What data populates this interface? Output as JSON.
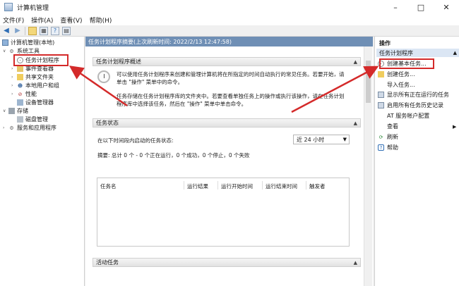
{
  "window": {
    "title": "计算机管理",
    "minimize": "–",
    "maximize": "□",
    "close": "✕"
  },
  "menu": [
    "文件(F)",
    "操作(A)",
    "查看(V)",
    "帮助(H)"
  ],
  "tree": {
    "root": "计算机管理(本地)",
    "system_tools": "系统工具",
    "task_scheduler": "任务计划程序",
    "event_viewer": "事件查看器",
    "shared_folders": "共享文件夹",
    "local_users": "本地用户和组",
    "performance": "性能",
    "device_manager": "设备管理器",
    "storage": "存储",
    "disk_management": "磁盘管理",
    "services_apps": "服务和应用程序"
  },
  "center": {
    "header": "任务计划程序摘要(上次刷新时间: 2022/2/13 12:47:58)",
    "overview_title": "任务计划程序概述",
    "overview_p1_l1": "可以使用任务计划程序来创建和管理计算机将在所指定的时间自动执行的常见任务。若要开始，请",
    "overview_p1_l2": "单击 \"操作\" 菜单中的命令。",
    "overview_p2_l1": "任务存储在任务计划程序库的文件夹中。若要查看单独任务上的操作或执行该操作，请在任务计划",
    "overview_p2_l2": "程序库中选择该任务，然后在 \"操作\" 菜单中单击命令。",
    "status_title": "任务状态",
    "status_label": "在以下时间段内启动的任务状态:",
    "status_period": "近 24 小时",
    "summary": "摘要: 总计 0 个 - 0 个正在运行，0 个成功，0 个停止，0 个失败",
    "columns": [
      "任务名",
      "运行结果",
      "运行开始时间",
      "运行结束时间",
      "触发者"
    ],
    "active_title": "活动任务"
  },
  "actions": {
    "title": "操作",
    "subheader": "任务计划程序",
    "items": [
      "创建基本任务...",
      "创建任务...",
      "导入任务...",
      "显示所有正在运行的任务",
      "启用所有任务历史记录",
      "AT 服务帐户配置",
      "查看",
      "刷新",
      "帮助"
    ]
  },
  "colors": {
    "header_blue": "#6f8fb5",
    "highlight_red": "#d42a2a",
    "selection": "#dbe6f4"
  }
}
